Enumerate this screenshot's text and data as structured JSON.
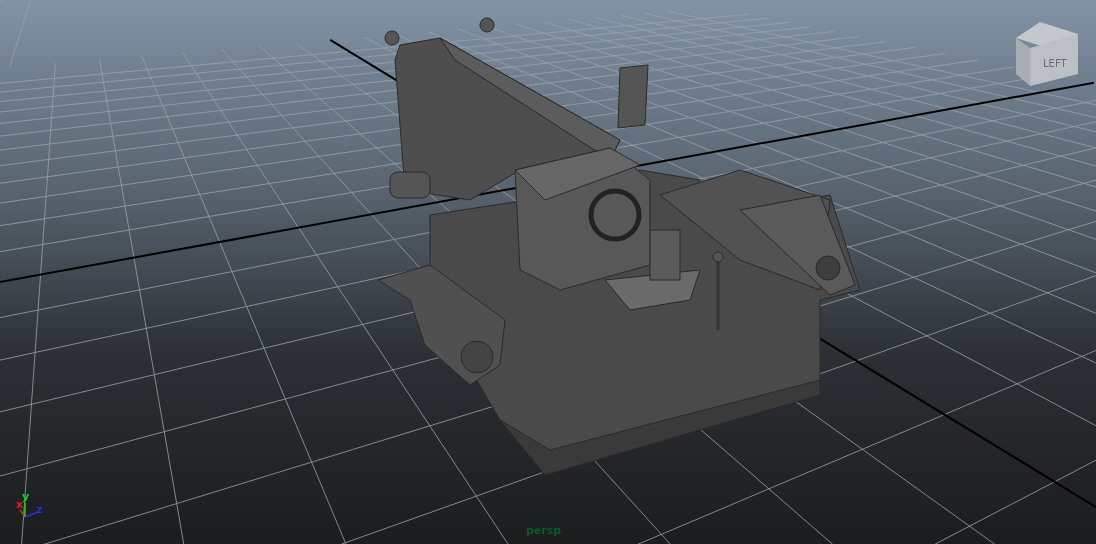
{
  "viewport": {
    "camera_label": "persp",
    "view_cube": {
      "face_label": "LEFT"
    },
    "axis_gizmo": [
      {
        "label": "x",
        "color": "#e02020"
      },
      {
        "label": "y",
        "color": "#20d020"
      },
      {
        "label": "z",
        "color": "#2030e0"
      }
    ]
  }
}
